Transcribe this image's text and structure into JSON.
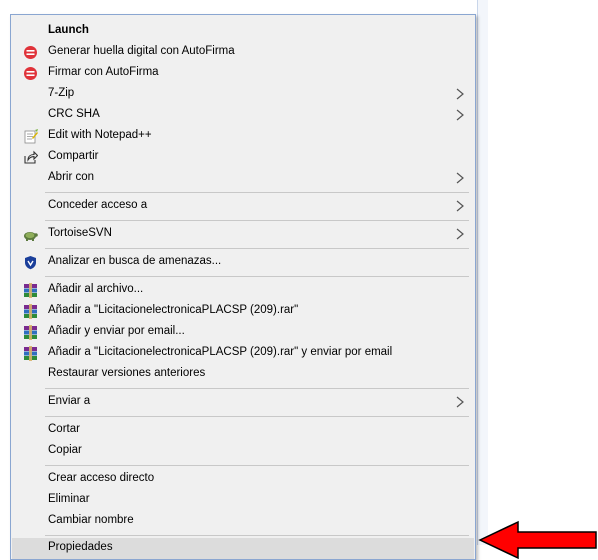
{
  "menu": {
    "items": [
      {
        "label": "Launch",
        "bold": true,
        "icon": null,
        "submenu": false
      },
      {
        "label": "Generar huella digital con AutoFirma",
        "icon": "autofirma-icon",
        "submenu": false
      },
      {
        "label": "Firmar con AutoFirma",
        "icon": "autofirma-icon",
        "submenu": false
      },
      {
        "label": "7-Zip",
        "icon": null,
        "submenu": true
      },
      {
        "label": "CRC SHA",
        "icon": null,
        "submenu": true
      },
      {
        "label": "Edit with Notepad++",
        "icon": "notepad-plus-plus-icon",
        "submenu": false
      },
      {
        "label": "Compartir",
        "icon": "share-icon",
        "submenu": false
      },
      {
        "label": "Abrir con",
        "icon": null,
        "submenu": true
      },
      {
        "label": "Conceder acceso a",
        "icon": null,
        "submenu": true
      },
      {
        "label": "TortoiseSVN",
        "icon": "tortoisesvn-icon",
        "submenu": true
      },
      {
        "label": "Analizar en busca de amenazas...",
        "icon": "defender-shield-icon",
        "submenu": false
      },
      {
        "label": "Añadir al archivo...",
        "icon": "winrar-icon",
        "submenu": false
      },
      {
        "label": "Añadir a \"LicitacionelectronicaPLACSP (209).rar\"",
        "icon": "winrar-icon",
        "submenu": false
      },
      {
        "label": "Añadir y enviar por email...",
        "icon": "winrar-icon",
        "submenu": false
      },
      {
        "label": "Añadir a \"LicitacionelectronicaPLACSP (209).rar\" y enviar por email",
        "icon": "winrar-icon",
        "submenu": false
      },
      {
        "label": "Restaurar versiones anteriores",
        "icon": null,
        "submenu": false
      },
      {
        "label": "Enviar a",
        "icon": null,
        "submenu": true
      },
      {
        "label": "Cortar",
        "icon": null,
        "submenu": false
      },
      {
        "label": "Copiar",
        "icon": null,
        "submenu": false
      },
      {
        "label": "Crear acceso directo",
        "icon": null,
        "submenu": false
      },
      {
        "label": "Eliminar",
        "icon": null,
        "submenu": false
      },
      {
        "label": "Cambiar nombre",
        "icon": null,
        "submenu": false
      },
      {
        "label": "Propiedades",
        "icon": null,
        "submenu": false,
        "highlighted": true
      }
    ]
  },
  "colors": {
    "menu_bg": "#f0f0f0",
    "menu_border": "#8aa6d1",
    "highlight_bg": "#dcdcdc",
    "arrow_fill": "#ff0000",
    "autofirma": "#e0333a",
    "winrar": "#7a2b8f",
    "defender": "#1b3f9a"
  },
  "annotation": {
    "arrow_icon": "red-arrow-pointing-left"
  }
}
